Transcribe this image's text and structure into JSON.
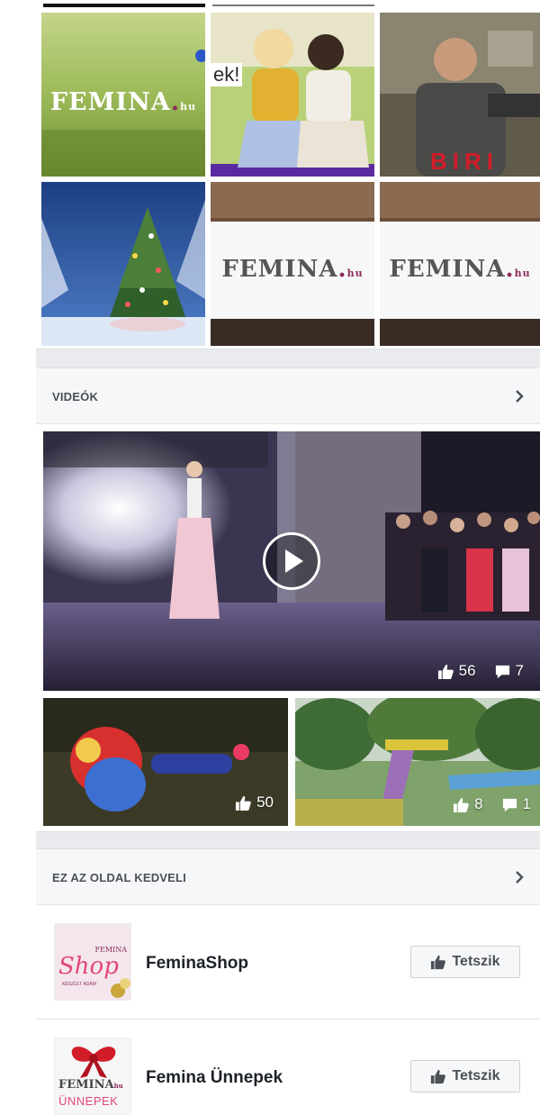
{
  "photos": {
    "logo_word": "FEMINA",
    "logo_dot": ".",
    "logo_suffix": "hu",
    "fragment_text": "ek!",
    "movie_text": "BIRI"
  },
  "videos": {
    "title": "VIDEÓK",
    "main": {
      "likes": "56",
      "comments": "7"
    },
    "thumb1": {
      "likes": "50"
    },
    "thumb2": {
      "likes": "8",
      "comments": "1"
    }
  },
  "liked_pages": {
    "title": "EZ AZ OLDAL KEDVELI",
    "items": [
      {
        "name": "FeminaShop",
        "button_label": "Tetszik",
        "thumb_word": "FEMINA",
        "thumb_script": "Shop",
        "thumb_sub": "KÉSZÜLT ÁDÁM"
      },
      {
        "name": "Femina Ünnepek",
        "button_label": "Tetszik",
        "thumb_word": "FEMINA",
        "thumb_suffix": "hu",
        "thumb_sub": "ÜNNEPEK"
      }
    ]
  },
  "colors": {
    "brand_plum": "#8d2a5b",
    "page_bg": "#e9ebee",
    "header_bg": "#f6f7f9"
  }
}
